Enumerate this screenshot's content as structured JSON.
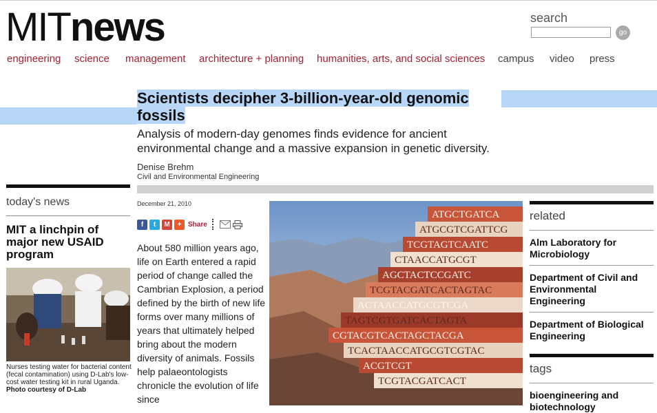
{
  "logo": {
    "mit": "MIT",
    "news": "news"
  },
  "search": {
    "label": "search",
    "placeholder": "",
    "go_label": "go"
  },
  "nav": [
    {
      "label": "engineering"
    },
    {
      "label": "science"
    },
    {
      "label": "management"
    },
    {
      "label": "architecture + planning"
    },
    {
      "label": "humanities, arts, and social sciences"
    },
    {
      "label": "campus"
    },
    {
      "label": "video"
    },
    {
      "label": "press"
    }
  ],
  "article": {
    "headline_line1": "Scientists decipher 3-billion-year-old genomic",
    "headline_line2": "fossils",
    "subhead": "Analysis of modern-day genomes finds evidence for ancient environmental change and a massive expansion in genetic diversity.",
    "author": "Denise Brehm",
    "department": "Civil and Environmental Engineering",
    "date": "December 21, 2010",
    "share_label": "Share",
    "body": "About 580 million years ago, life on Earth entered a rapid period of change called the Cambrian Explosion, a period defined by the birth of new life forms over many millions of years that ultimately helped bring about the modern diversity of animals. Fossils help palaeontologists chronicle the evolution of life since"
  },
  "today": {
    "heading": "today's news",
    "lead_title": "MIT a linchpin of major new USAID program",
    "caption": "Nurses testing water for bacterial content (fecal contamination) using D-Lab's low-cost water testing kit in rural Uganda.",
    "credit": "Photo courtesy of D-Lab"
  },
  "related": {
    "heading": "related",
    "links": [
      {
        "label": "Alm Laboratory for Microbiology"
      },
      {
        "label": "Department of Civil and Environmental Engineering"
      },
      {
        "label": "Department of Biological Engineering"
      }
    ]
  },
  "tags": {
    "heading": "tags",
    "items": [
      {
        "label": "bioengineering and biotechnology"
      }
    ]
  },
  "art_dna": [
    "ATGCTGATCA",
    "ATGCGTCGATTCG",
    "TCGTAGTCAATC",
    "CTAACCATGCGT",
    "AGCTACTCCGATC",
    "TCGTACGATCACTAGTAC",
    "ACTAACCATGCGTCGA",
    "TAGTCGTGATCACTAGTA",
    "CGTACGTCACTAGCTACGA",
    "TCACTAACCATGCGTCGTAC",
    "ACGTCGT",
    "TCGTACGATCACT"
  ],
  "colors": {
    "brand_red": "#a31f34",
    "highlight": "#b8d6f8",
    "rule_gray": "#d0d0d0"
  }
}
